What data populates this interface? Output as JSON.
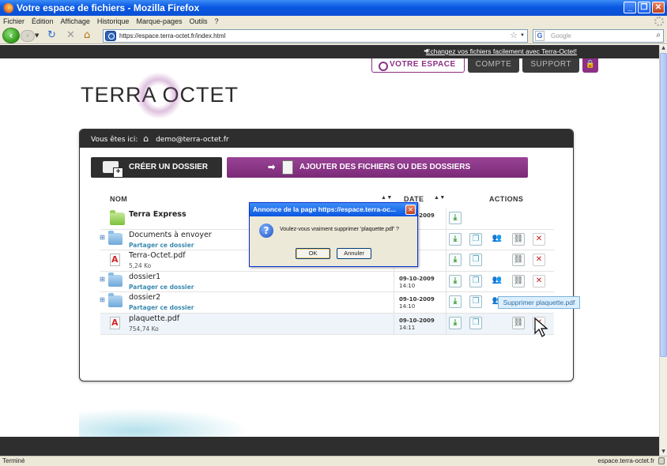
{
  "window": {
    "title": "Votre espace de fichiers - Mozilla Firefox"
  },
  "menu": [
    "Fichier",
    "Édition",
    "Affichage",
    "Historique",
    "Marque-pages",
    "Outils",
    "?"
  ],
  "nav": {
    "url": "https://espace.terra-octet.fr/index.html",
    "search_placeholder": "Google",
    "search_engine_letter": "G"
  },
  "site": {
    "promo": "Echangez vos fichiers facilement avec Terra-Octet!",
    "tabs": {
      "espace": "VOTRE ESPACE",
      "compte": "COMPTE",
      "support": "SUPPORT"
    },
    "logo": "TERRA OCTET",
    "breadcrumb_label": "Vous êtes ici:",
    "breadcrumb_user": "demo@terra-octet.fr",
    "create_label": "CRÉER UN DOSSIER",
    "add_label": "AJOUTER DES FICHIERS OU DES DOSSIERS",
    "headers": {
      "name": "NOM",
      "date": "DATE",
      "actions": "ACTIONS"
    },
    "rows": [
      {
        "name": "Terra Express",
        "sub": "",
        "date": "09-10-2009",
        "time": "",
        "type": "express"
      },
      {
        "name": "Documents à envoyer",
        "sub": "Partager ce dossier",
        "date": "",
        "time": "",
        "type": "folder"
      },
      {
        "name": "Terra-Octet.pdf",
        "sub": "5,24 Ko",
        "date": "",
        "time": "",
        "type": "pdf"
      },
      {
        "name": "dossier1",
        "sub": "Partager ce dossier",
        "date": "09-10-2009",
        "time": "14:10",
        "type": "folder"
      },
      {
        "name": "dossier2",
        "sub": "Partager ce dossier",
        "date": "09-10-2009",
        "time": "14:10",
        "type": "folder"
      },
      {
        "name": "plaquette.pdf",
        "sub": "754,74 Ko",
        "date": "09-10-2009",
        "time": "14:11",
        "type": "pdf"
      }
    ],
    "tooltip": "Supprimer plaquette.pdf"
  },
  "dialog": {
    "title": "Annonce de la page  https://espace.terra-oc...",
    "message": "Voulez-vous vraiment supprimer 'plaquette.pdf' ?",
    "ok": "OK",
    "cancel": "Annuler"
  },
  "status": {
    "left": "Terminé",
    "right": "espace.terra-octet.fr"
  },
  "colors": {
    "accent": "#8c2f86",
    "dark": "#2e2e2e",
    "xp_blue": "#0a58e2"
  }
}
